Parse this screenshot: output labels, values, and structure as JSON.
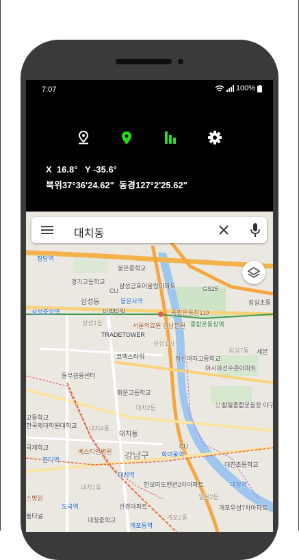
{
  "status": {
    "time": "7:07",
    "battery": "100%"
  },
  "toolbar": {
    "icons": [
      "pin-outline-icon",
      "location-pin-icon",
      "bar-chart-icon",
      "settings-gear-icon"
    ],
    "colors": {
      "white": "#ffffff",
      "green": "#22dd22"
    }
  },
  "coords": {
    "line1": "X  16.8°   Y -35.6°",
    "line2": "북위37°36'24.62\"  동경127°2'25.62\""
  },
  "search": {
    "query": "대치동"
  },
  "map": {
    "labels": [
      "청담역",
      "봉은중학교",
      "경기고등학교",
      "삼성금호어울림아파트",
      "GS25",
      "잠실초등",
      "삼성동",
      "CU",
      "봉은사역",
      "삼성중앙역",
      "아셈타워",
      "종합운동장119",
      "서울의료원 강남분원",
      "종합운동장역",
      "삼성1동",
      "TRADETOWER",
      "삼성119",
      "잠실7동",
      "세븐",
      "코엑스타워",
      "정신여자고등학교",
      "아시아선수촌아파트",
      "동부금융센터",
      "휘문고등학교",
      "대치2동",
      "잠실야구장",
      "잠실종합운동장 야구장",
      "고등학교",
      "한국제대학원대학교",
      "대치4동",
      "대치동",
      "국제학교",
      "베스티안병원",
      "강남구",
      "학여울역",
      "CU",
      "한티역",
      "대치역",
      "대진초등학교",
      "한보미도맨션2차아파트",
      "대치1동",
      "대청역",
      "일원2동",
      "스병원",
      "도곡역",
      "선경아파트",
      "개포우성7차아파트",
      "틀터널",
      "대청중학교",
      "개포동역",
      "개포2동"
    ]
  }
}
